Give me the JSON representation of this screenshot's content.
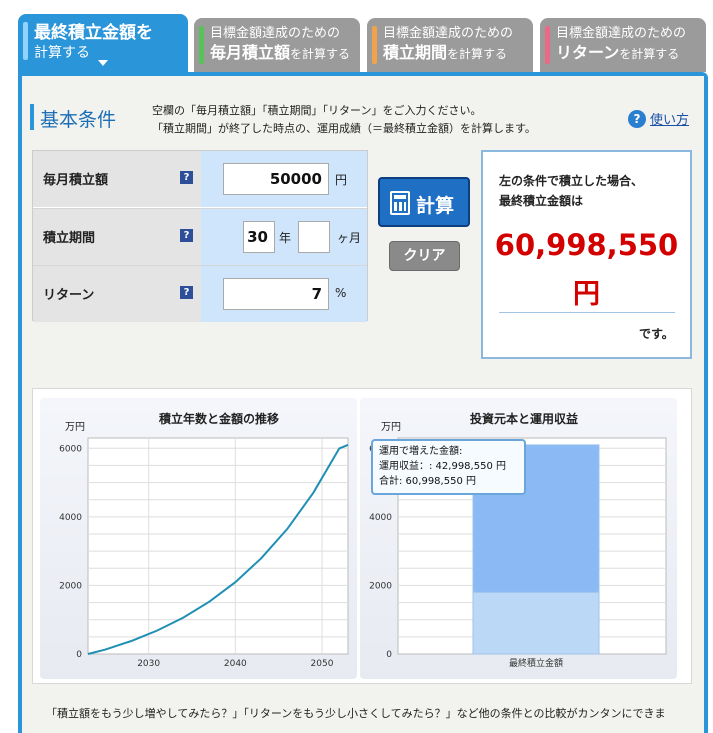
{
  "tabs": [
    {
      "line1": "最終積立金額を",
      "line2": "計算する",
      "color": "#2a95d8",
      "bar": "#8fd3ff"
    },
    {
      "line1": "目標金額達成のための",
      "line2_big": "毎月積立額",
      "line2_small": "を計算する",
      "bar": "#58c258"
    },
    {
      "line1": "目標金額達成のための",
      "line2_big": "積立期間",
      "line2_small": "を計算する",
      "bar": "#f2a24a"
    },
    {
      "line1": "目標金額達成のための",
      "line2_big": "リターン",
      "line2_small": "を計算する",
      "bar": "#ea6a86"
    }
  ],
  "section": {
    "title": "基本条件",
    "desc1": "空欄の「毎月積立額」「積立期間」「リターン」をご入力ください。",
    "desc2": "「積立期間」が終了した時点の、運用成績（＝最終積立金額）を計算します。",
    "help_icon": "?",
    "help_label": "使い方"
  },
  "form": {
    "monthly": {
      "label": "毎月積立額",
      "value": "50000",
      "unit": "円"
    },
    "period": {
      "label": "積立期間",
      "years": "30",
      "years_unit": "年",
      "months": "",
      "months_unit": "ヶ月"
    },
    "return": {
      "label": "リターン",
      "value": "7",
      "unit": "%"
    },
    "q_icon": "?"
  },
  "buttons": {
    "calc": "計算",
    "clear": "クリア"
  },
  "result": {
    "line1": "左の条件で積立した場合、",
    "line2": "最終積立金額は",
    "amount": "60,998,550",
    "yen": "円",
    "end": "です。"
  },
  "chart_data": [
    {
      "type": "line",
      "title": "積立年数と金額の推移",
      "unit_label": "万円",
      "x_ticks": [
        "2030",
        "2040",
        "2050"
      ],
      "y_ticks": [
        "0",
        "2000",
        "4000",
        "6000"
      ],
      "xlim": [
        2023,
        2053
      ],
      "ylim": [
        0,
        6300
      ],
      "x": [
        2023,
        2025,
        2028,
        2031,
        2034,
        2037,
        2040,
        2043,
        2046,
        2049,
        2052,
        2053
      ],
      "y": [
        0,
        128,
        378,
        685,
        1063,
        1526,
        2094,
        2793,
        3650,
        4703,
        5998,
        6100
      ],
      "color": "#1f8fb4"
    },
    {
      "type": "bar",
      "title": "投資元本と運用収益",
      "unit_label": "万円",
      "categories": [
        "最終積立金額"
      ],
      "y_ticks": [
        "0",
        "2000",
        "4000",
        "6000"
      ],
      "ylim": [
        0,
        6300
      ],
      "series": [
        {
          "values": [
            1800
          ],
          "color": "#bcd8f7"
        },
        {
          "values": [
            4299.855
          ],
          "color": "#8ab9f4"
        }
      ]
    }
  ],
  "tooltip": {
    "title": "運用で増えた金額:",
    "line1": "運用収益：: 42,998,550 円",
    "line2": "合計: 60,998,550 円"
  },
  "footer": "「積立額をもう少し増やしてみたら？」「リターンをもう少し小さくしてみたら？」など他の条件との比較がカンタンにできま"
}
